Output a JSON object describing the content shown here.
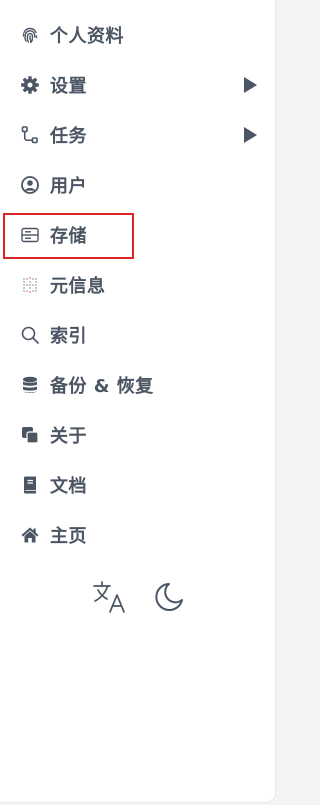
{
  "menu": {
    "items": [
      {
        "label": "个人资料",
        "icon": "fingerprint-icon"
      },
      {
        "label": "设置",
        "icon": "gear-icon",
        "has_submenu": true
      },
      {
        "label": "任务",
        "icon": "workflow-icon",
        "has_submenu": true
      },
      {
        "label": "用户",
        "icon": "user-circle-icon"
      },
      {
        "label": "存储",
        "icon": "storage-icon",
        "selected": true
      },
      {
        "label": "元信息",
        "icon": "dotted-grid-icon"
      },
      {
        "label": "索引",
        "icon": "search-icon"
      },
      {
        "label": "备份 & 恢复",
        "icon": "database-icon"
      },
      {
        "label": "关于",
        "icon": "copy-icon"
      },
      {
        "label": "文档",
        "icon": "book-icon"
      },
      {
        "label": "主页",
        "icon": "home-icon"
      }
    ]
  },
  "tools": {
    "language_icon": "translate-icon",
    "theme_icon": "moon-icon"
  },
  "colors": {
    "text": "#4b5563",
    "highlight_border": "#dc2626",
    "background": "#ffffff"
  }
}
